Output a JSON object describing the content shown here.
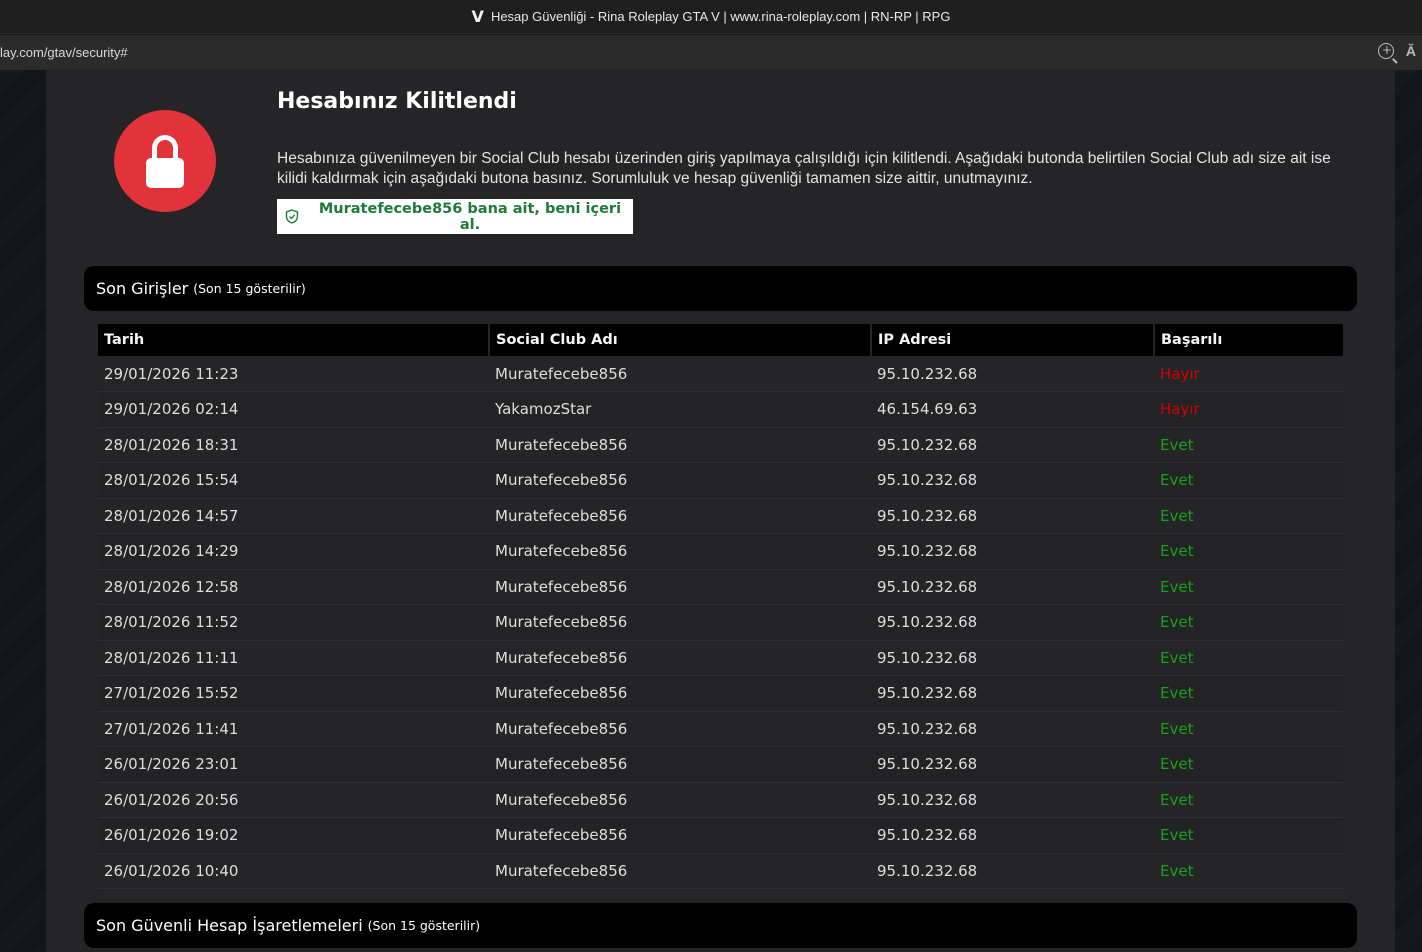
{
  "browser": {
    "title": "Hesap Güvenliği - Rina Roleplay GTA V | www.rina-roleplay.com | RN-RP | RPG",
    "logo": "V",
    "url": "lay.com/gtav/security#",
    "icons": [
      "zoom-icon",
      "read-aloud-icon"
    ],
    "read_aloud_glyph": "Ă"
  },
  "lock_notice": {
    "title": "Hesabınız Kilitlendi",
    "description": "Hesabınıza güvenilmeyen bir Social Club hesabı üzerinden giriş yapılmaya çalışıldığı için kilitlendi. Aşağıdaki butonda belirtilen Social Club adı size ait ise kilidi kaldırmak için aşağıdaki butona basınız. Sorumluluk ve hesap güvenliği tamamen size aittir, unutmayınız.",
    "claim_button": "Muratefecebe856 bana ait, beni içeri al.",
    "icon": "lock-icon",
    "accent_color": "#e2323a"
  },
  "recent_logins": {
    "heading": "Son Girişler",
    "subheading": "(Son 15 gösterilir)",
    "columns": [
      "Tarih",
      "Social Club Adı",
      "IP Adresi",
      "Başarılı"
    ],
    "rows": [
      [
        "29/01/2026 11:23",
        "Muratefecebe856",
        "95.10.232.68",
        "Hayır"
      ],
      [
        "29/01/2026 02:14",
        "YakamozStar",
        "46.154.69.63",
        "Hayır"
      ],
      [
        "28/01/2026 18:31",
        "Muratefecebe856",
        "95.10.232.68",
        "Evet"
      ],
      [
        "28/01/2026 15:54",
        "Muratefecebe856",
        "95.10.232.68",
        "Evet"
      ],
      [
        "28/01/2026 14:57",
        "Muratefecebe856",
        "95.10.232.68",
        "Evet"
      ],
      [
        "28/01/2026 14:29",
        "Muratefecebe856",
        "95.10.232.68",
        "Evet"
      ],
      [
        "28/01/2026 12:58",
        "Muratefecebe856",
        "95.10.232.68",
        "Evet"
      ],
      [
        "28/01/2026 11:52",
        "Muratefecebe856",
        "95.10.232.68",
        "Evet"
      ],
      [
        "28/01/2026 11:11",
        "Muratefecebe856",
        "95.10.232.68",
        "Evet"
      ],
      [
        "27/01/2026 15:52",
        "Muratefecebe856",
        "95.10.232.68",
        "Evet"
      ],
      [
        "27/01/2026 11:41",
        "Muratefecebe856",
        "95.10.232.68",
        "Evet"
      ],
      [
        "26/01/2026 23:01",
        "Muratefecebe856",
        "95.10.232.68",
        "Evet"
      ],
      [
        "26/01/2026 20:56",
        "Muratefecebe856",
        "95.10.232.68",
        "Evet"
      ],
      [
        "26/01/2026 19:02",
        "Muratefecebe856",
        "95.10.232.68",
        "Evet"
      ],
      [
        "26/01/2026 10:40",
        "Muratefecebe856",
        "95.10.232.68",
        "Evet"
      ]
    ],
    "status_colors": {
      "Evet": "#1aa01a",
      "Hayır": "#d40000"
    }
  },
  "trusted_marks": {
    "heading": "Son Güvenli Hesap İşaretlemeleri",
    "subheading": "(Son 15 gösterilir)"
  }
}
